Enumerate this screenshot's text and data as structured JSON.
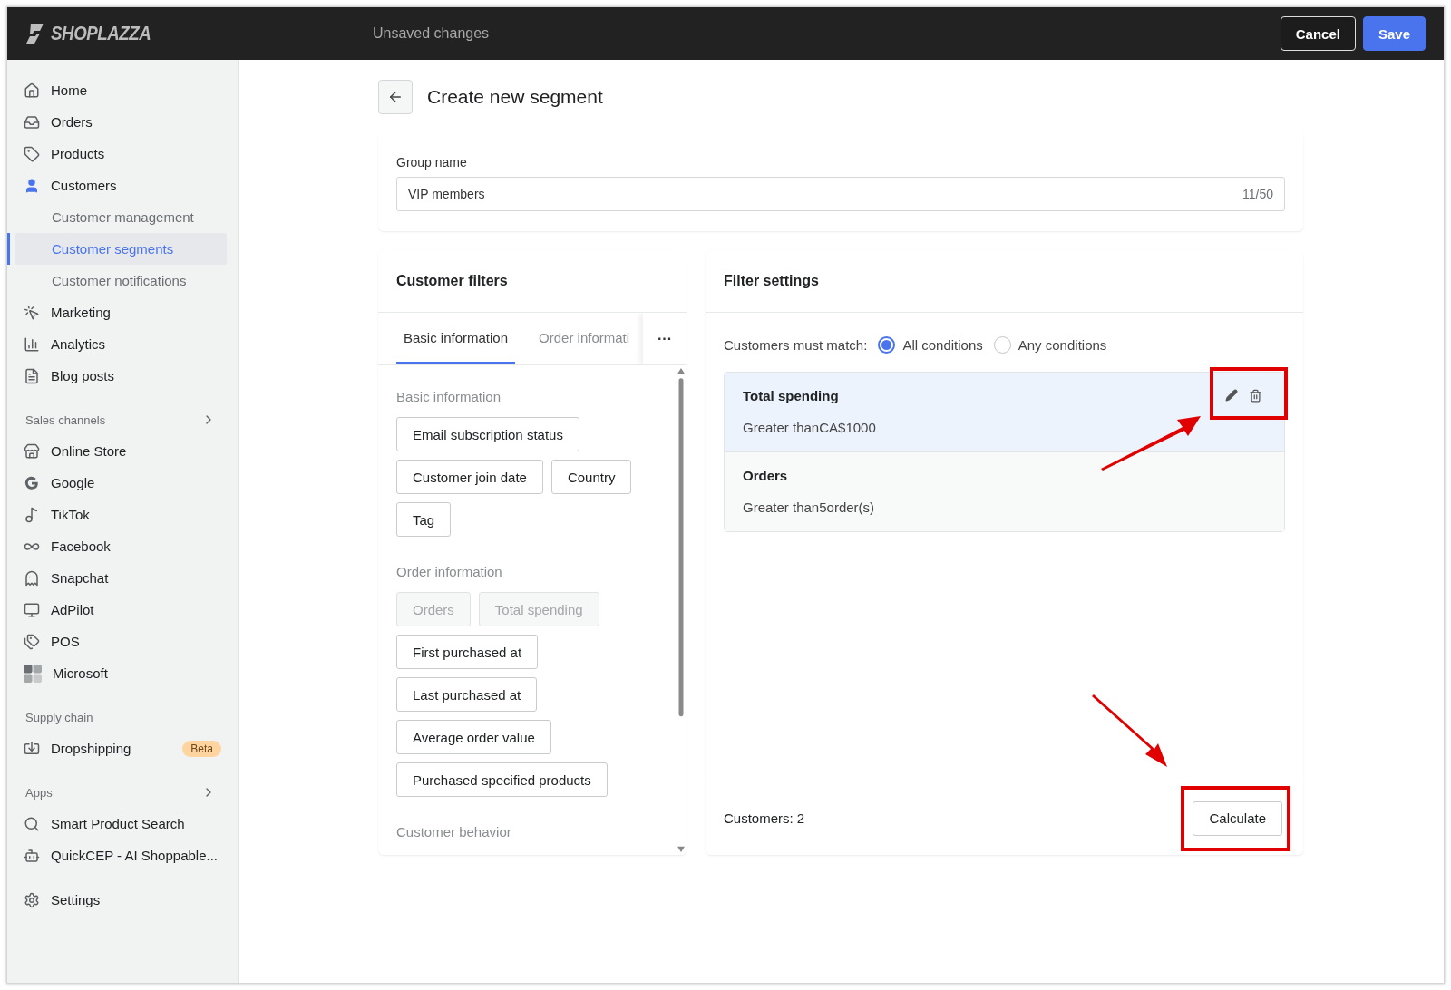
{
  "topbar": {
    "logo": "SHOPLAZZA",
    "status": "Unsaved changes",
    "buttons": [
      {
        "label": "Cancel",
        "kind": "outline"
      },
      {
        "label": "Save",
        "kind": "primary"
      }
    ]
  },
  "sidebar": {
    "sections": [
      {
        "items": [
          {
            "label": "Home",
            "selected": false
          },
          {
            "label": "Orders",
            "selected": false
          },
          {
            "label": "Products",
            "selected": false
          },
          {
            "label": "Customers",
            "selected": false,
            "children": [
              {
                "label": "Customer management",
                "selected": false
              },
              {
                "label": "Customer segments",
                "selected": true
              },
              {
                "label": "Customer notifications",
                "selected": false
              }
            ]
          },
          {
            "label": "Marketing",
            "selected": false
          },
          {
            "label": "Analytics",
            "selected": false
          },
          {
            "label": "Blog posts",
            "selected": false
          }
        ]
      },
      {
        "heading": "Sales channels",
        "expandable": true,
        "items": [
          {
            "label": "Online Store",
            "selected": false
          },
          {
            "label": "Google",
            "selected": false
          },
          {
            "label": "TikTok",
            "selected": false
          },
          {
            "label": "Facebook",
            "selected": false
          },
          {
            "label": "Snapchat",
            "selected": false
          },
          {
            "label": "AdPilot",
            "selected": false
          },
          {
            "label": "POS",
            "selected": false
          },
          {
            "label": "Microsoft",
            "selected": false
          }
        ]
      },
      {
        "heading": "Supply chain",
        "items": [
          {
            "label": "Dropshipping",
            "selected": false,
            "badge": "Beta"
          }
        ]
      },
      {
        "heading": "Apps",
        "expandable": true,
        "items": [
          {
            "label": "Smart Product Search",
            "selected": false
          },
          {
            "label": "QuickCEP - AI Shoppable...",
            "selected": false
          }
        ]
      },
      {
        "items": [
          {
            "label": "Settings",
            "selected": false
          }
        ]
      }
    ]
  },
  "page": {
    "title": "Create new segment"
  },
  "group": {
    "label": "Group name",
    "value": "VIP members",
    "counter": "11/50"
  },
  "filters": {
    "title": "Customer filters",
    "tabs": [
      {
        "label": "Basic information",
        "selected": true
      },
      {
        "label": "Order informati",
        "selected": false
      }
    ],
    "more": "···",
    "groups": [
      {
        "heading": "Basic information",
        "options": [
          {
            "label": "Email subscription status",
            "disabled": false
          },
          {
            "label": "Customer join date",
            "disabled": false
          },
          {
            "label": "Country",
            "disabled": false
          },
          {
            "label": "Tag",
            "disabled": false
          }
        ]
      },
      {
        "heading": "Order information",
        "options": [
          {
            "label": "Orders",
            "disabled": true
          },
          {
            "label": "Total spending",
            "disabled": true
          },
          {
            "label": "First purchased at",
            "disabled": false
          },
          {
            "label": "Last purchased at",
            "disabled": false
          },
          {
            "label": "Average order value",
            "disabled": false
          },
          {
            "label": "Purchased specified products",
            "disabled": false
          }
        ]
      },
      {
        "heading": "Customer behavior"
      }
    ]
  },
  "settings": {
    "title": "Filter settings",
    "match_label": "Customers must match:",
    "match_options": [
      {
        "label": "All conditions",
        "selected": true
      },
      {
        "label": "Any conditions",
        "selected": false
      }
    ],
    "conditions": [
      {
        "title": "Total spending",
        "description": "Greater thanCA$1000",
        "selected": true,
        "actions_highlighted": true
      },
      {
        "title": "Orders",
        "description": "Greater than5order(s)",
        "selected": false
      }
    ],
    "count": "Customers: 2",
    "calculate": {
      "label": "Calculate",
      "highlighted": true
    }
  }
}
